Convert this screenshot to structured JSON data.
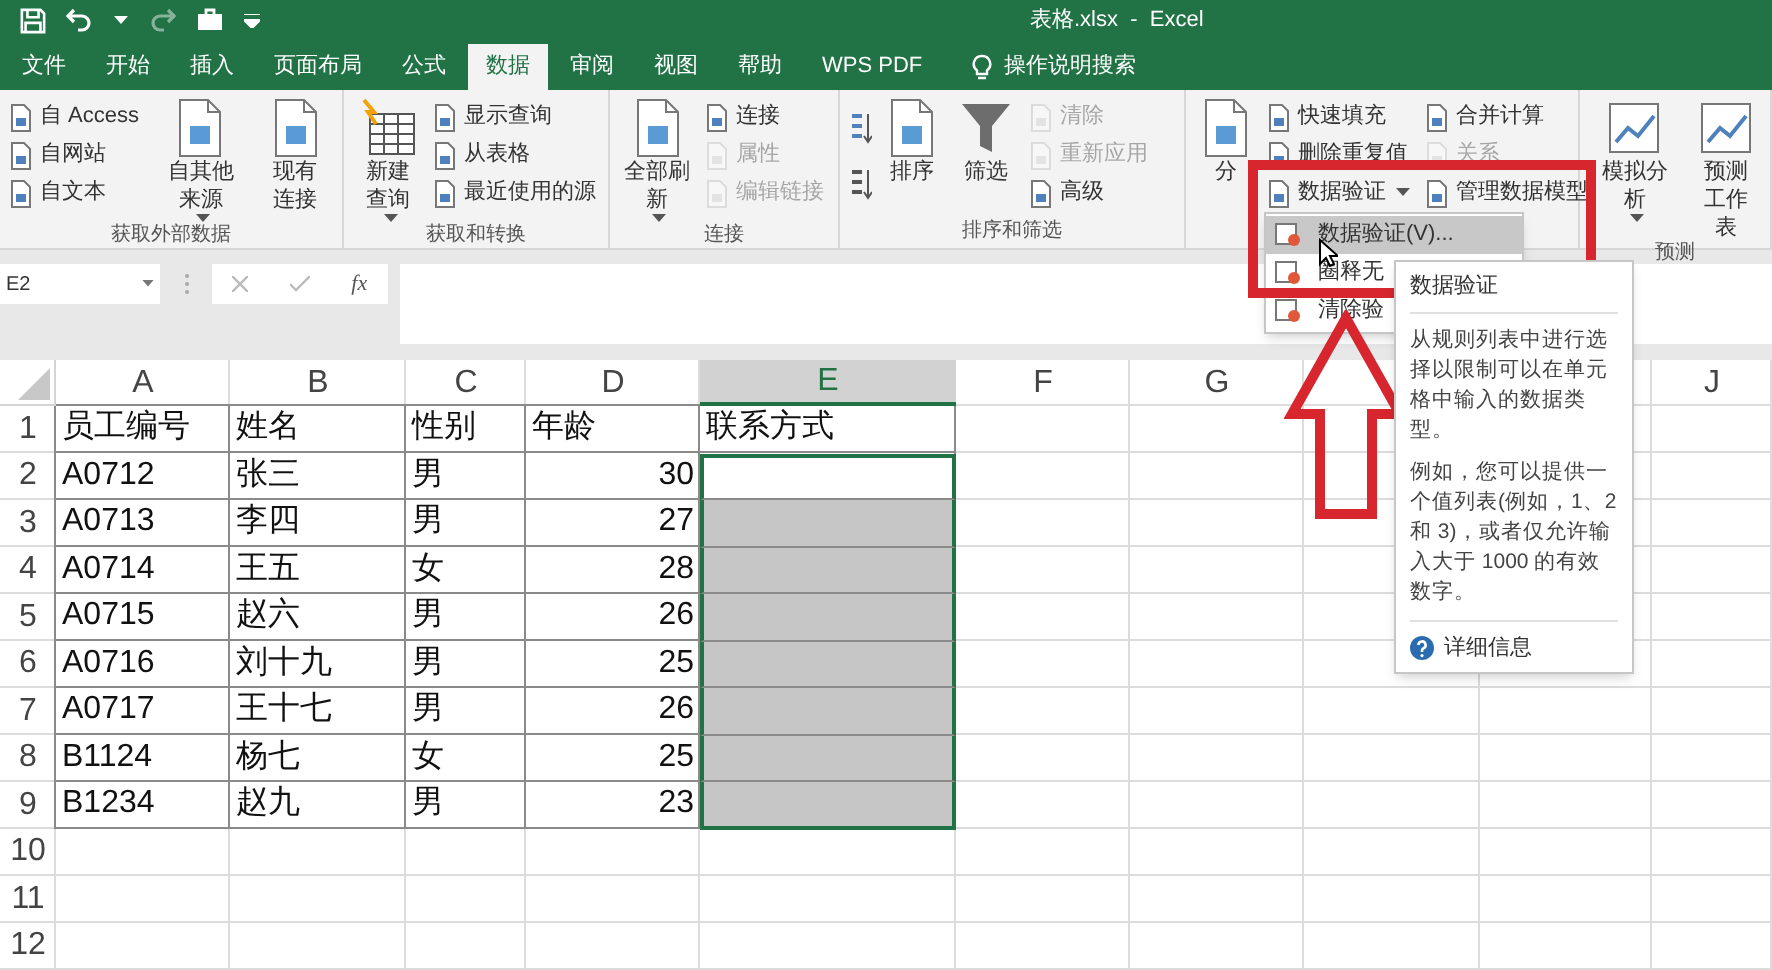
{
  "window": {
    "title": "表格.xlsx  -  Excel"
  },
  "tabs": [
    {
      "label": "文件",
      "selected": false
    },
    {
      "label": "开始",
      "selected": false
    },
    {
      "label": "插入",
      "selected": false
    },
    {
      "label": "页面布局",
      "selected": false
    },
    {
      "label": "公式",
      "selected": false
    },
    {
      "label": "数据",
      "selected": true
    },
    {
      "label": "审阅",
      "selected": false
    },
    {
      "label": "视图",
      "selected": false
    },
    {
      "label": "帮助",
      "selected": false
    },
    {
      "label": "WPS PDF",
      "selected": false
    }
  ],
  "tell_me": "操作说明搜索",
  "ribbon_groups": [
    {
      "label": "获取外部数据",
      "columns": [
        [
          {
            "kind": "small",
            "label": "自 Access",
            "disabled": false
          },
          {
            "kind": "small",
            "label": "自网站",
            "disabled": false
          },
          {
            "kind": "small",
            "label": "自文本",
            "disabled": false
          }
        ],
        [
          {
            "kind": "large_menu",
            "label": "自其他来源",
            "disabled": false
          }
        ],
        [
          {
            "kind": "large",
            "label": "现有连接",
            "disabled": false
          }
        ]
      ]
    },
    {
      "label": "获取和转换",
      "columns": [
        [
          {
            "kind": "large_menu",
            "lines": [
              "新建",
              "查询"
            ],
            "disabled": false
          }
        ],
        [
          {
            "kind": "small",
            "label": "显示查询",
            "disabled": false
          },
          {
            "kind": "small",
            "label": "从表格",
            "disabled": false
          },
          {
            "kind": "small",
            "label": "最近使用的源",
            "disabled": false
          }
        ]
      ]
    },
    {
      "label": "连接",
      "columns": [
        [
          {
            "kind": "large_menu",
            "label": "全部刷新",
            "disabled": false
          }
        ],
        [
          {
            "kind": "small",
            "label": "连接",
            "disabled": false
          },
          {
            "kind": "small",
            "label": "属性",
            "disabled": true
          },
          {
            "kind": "small",
            "label": "编辑链接",
            "disabled": true
          }
        ]
      ]
    },
    {
      "label": "排序和筛选",
      "columns": [
        [
          {
            "kind": "sort_pair"
          }
        ],
        [
          {
            "kind": "large",
            "label": "排序",
            "disabled": false
          }
        ],
        [
          {
            "kind": "large",
            "label": "筛选",
            "disabled": false
          }
        ],
        [
          {
            "kind": "small",
            "label": "清除",
            "disabled": true
          },
          {
            "kind": "small",
            "label": "重新应用",
            "disabled": true
          },
          {
            "kind": "small",
            "label": "高级",
            "disabled": false
          }
        ]
      ]
    },
    {
      "columns": [
        [
          {
            "kind": "large",
            "label": "分",
            "disabled": false
          }
        ],
        [
          {
            "kind": "small",
            "label": "快速填充",
            "disabled": false
          },
          {
            "kind": "small",
            "label": "删除重复值",
            "disabled": false
          },
          {
            "kind": "small_menu",
            "label": "数据验证",
            "disabled": false
          }
        ],
        [
          {
            "kind": "small",
            "label": "合并计算",
            "disabled": false
          },
          {
            "kind": "small",
            "label": "关系",
            "disabled": true
          },
          {
            "kind": "small",
            "label": "管理数据模型",
            "disabled": false
          }
        ]
      ]
    },
    {
      "label": "预测",
      "columns": [
        [
          {
            "kind": "large_menu",
            "label": "模拟分析",
            "disabled": false
          }
        ],
        [
          {
            "kind": "large",
            "lines": [
              "预测",
              "工作表"
            ],
            "disabled": false
          }
        ]
      ]
    }
  ],
  "formula_bar": {
    "name_box": "E2",
    "fx": "fx"
  },
  "columns": [
    {
      "label": "A",
      "selected": false
    },
    {
      "label": "B",
      "selected": false
    },
    {
      "label": "C",
      "selected": false
    },
    {
      "label": "D",
      "selected": false
    },
    {
      "label": "E",
      "selected": true
    },
    {
      "label": "F",
      "selected": false
    },
    {
      "label": "G",
      "selected": false
    },
    {
      "selected": false
    },
    {
      "selected": false
    },
    {
      "label": "J",
      "selected": false
    }
  ],
  "rows": [
    {
      "label": "1",
      "cells": [
        "员工编号",
        "姓名",
        "性别",
        "年龄",
        "联系方式"
      ],
      "selected": false,
      "active": false
    },
    {
      "label": "2",
      "cells": [
        "A0712",
        "张三",
        "男",
        "30"
      ],
      "selected": true,
      "active": true
    },
    {
      "label": "3",
      "cells": [
        "A0713",
        "李四",
        "男",
        "27"
      ],
      "selected": true,
      "active": false
    },
    {
      "label": "4",
      "cells": [
        "A0714",
        "王五",
        "女",
        "28"
      ],
      "selected": true,
      "active": false
    },
    {
      "label": "5",
      "cells": [
        "A0715",
        "赵六",
        "男",
        "26"
      ],
      "selected": true,
      "active": false
    },
    {
      "label": "6",
      "cells": [
        "A0716",
        "刘十九",
        "男",
        "25"
      ],
      "selected": true,
      "active": false
    },
    {
      "label": "7",
      "cells": [
        "A0717",
        "王十七",
        "男",
        "26"
      ],
      "selected": true,
      "active": false
    },
    {
      "label": "8",
      "cells": [
        "B1124",
        "杨七",
        "女",
        "25"
      ],
      "selected": true,
      "active": false
    },
    {
      "label": "9",
      "cells": [
        "B1234",
        "赵九",
        "男",
        "23"
      ],
      "selected": true,
      "active": false
    },
    {
      "label": "10",
      "selected": false,
      "active": false
    },
    {
      "label": "11",
      "selected": false,
      "active": false
    },
    {
      "label": "12",
      "selected": false,
      "active": false
    }
  ],
  "dropdown_menu": [
    {
      "label": "数据验证(V)...",
      "selected": true
    },
    {
      "label": "圈释无",
      "selected": false
    },
    {
      "label": "清除验",
      "selected": false
    }
  ],
  "tooltip": {
    "title": "数据验证",
    "paragraphs": [
      "从规则列表中进行选择以限制可以在单元格中输入的数据类型。",
      "例如，您可以提供一个值列表(例如，1、2 和 3)，或者仅允许输入大于 1000 的有效数字。"
    ],
    "link": "详细信息"
  }
}
